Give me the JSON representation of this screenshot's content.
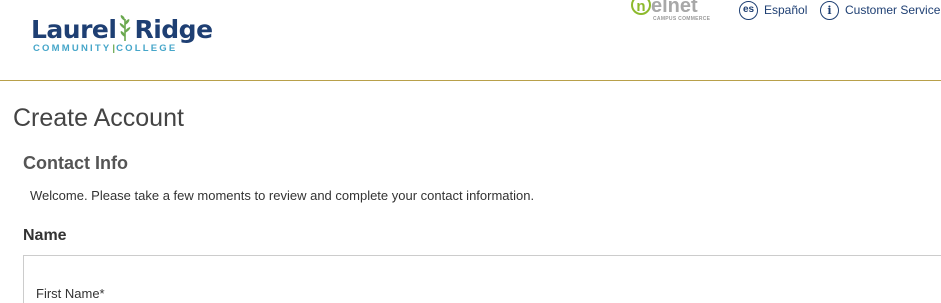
{
  "header": {
    "logo": {
      "main_left": "Laurel",
      "main_right": "Ridge",
      "sub_left": "COMMUNITY",
      "sub_right": "COLLEGE"
    },
    "partner_logo": {
      "word": "elnet",
      "initial": "n",
      "tagline": "CAMPUS COMMERCE"
    },
    "links": {
      "espanol": {
        "icon_text": "es",
        "label": "Español"
      },
      "customer_service": {
        "icon_text": "i",
        "label": "Customer Service"
      }
    }
  },
  "main": {
    "title": "Create Account",
    "section": {
      "title": "Contact Info",
      "welcome": "Welcome. Please take a few moments to review and complete your contact information."
    },
    "name_group": {
      "title": "Name",
      "first_name_label": "First Name*"
    }
  },
  "colors": {
    "brand_navy": "#1e3f73",
    "brand_teal": "#46a6c9",
    "leaf_green": "#6aa84f",
    "nelnet_green": "#8dba2d",
    "header_rule": "#b8a04a"
  }
}
